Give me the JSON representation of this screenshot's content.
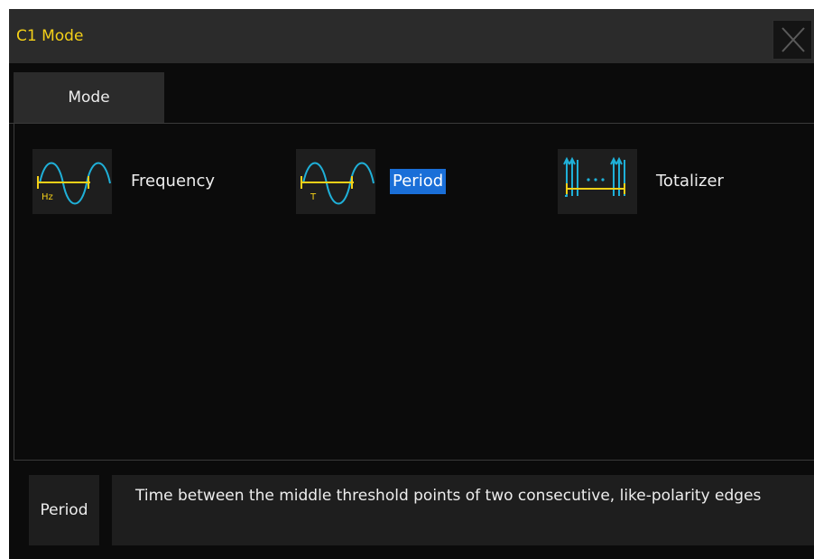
{
  "dialog": {
    "title": "C1 Mode"
  },
  "tabs": [
    {
      "label": "Mode"
    }
  ],
  "modes": [
    {
      "label": "Frequency",
      "icon": "frequency-sine-icon",
      "icon_text": "Hz",
      "selected": false
    },
    {
      "label": "Period",
      "icon": "period-sine-icon",
      "icon_text": "T",
      "selected": true
    },
    {
      "label": "Totalizer",
      "icon": "totalizer-edges-icon",
      "icon_text": "",
      "selected": false
    }
  ],
  "description": {
    "label": "Period",
    "text": "Time between the middle threshold points of two consecutive, like-polarity edges"
  },
  "colors": {
    "title_text": "#f4d018",
    "selection": "#1a6fd8",
    "waveform": "#1fb0d8",
    "marker": "#f4d018",
    "background": "#0b0b0b",
    "panel": "#1e1e1e"
  }
}
